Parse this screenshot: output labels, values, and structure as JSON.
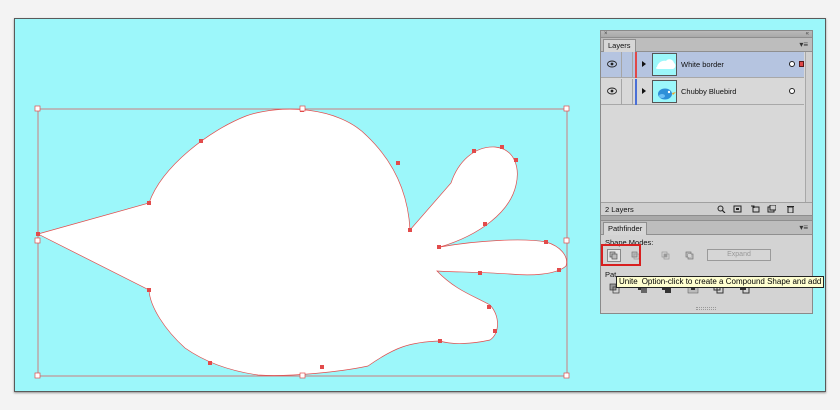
{
  "layers_panel": {
    "tab_label": "Layers",
    "layers": [
      {
        "name": "White border",
        "selected": true,
        "color": "#e04848",
        "thumb": "cloud"
      },
      {
        "name": "Chubby Bluebird",
        "selected": false,
        "color": "#4a6fd6",
        "thumb": "bird"
      }
    ],
    "count_label": "2 Layers"
  },
  "pathfinder_panel": {
    "tab_label": "Pathfinder",
    "shape_modes_label": "Shape Modes:",
    "expand_label": "Expand",
    "pathfinders_label_visible": "Pat"
  },
  "tooltip": {
    "name": "Unite",
    "text": "Option-click to create a Compound Shape and add t"
  },
  "colors": {
    "artboard": "#9cf7fa",
    "path_stroke": "#e24b4b",
    "highlight": "#d81f1f"
  }
}
